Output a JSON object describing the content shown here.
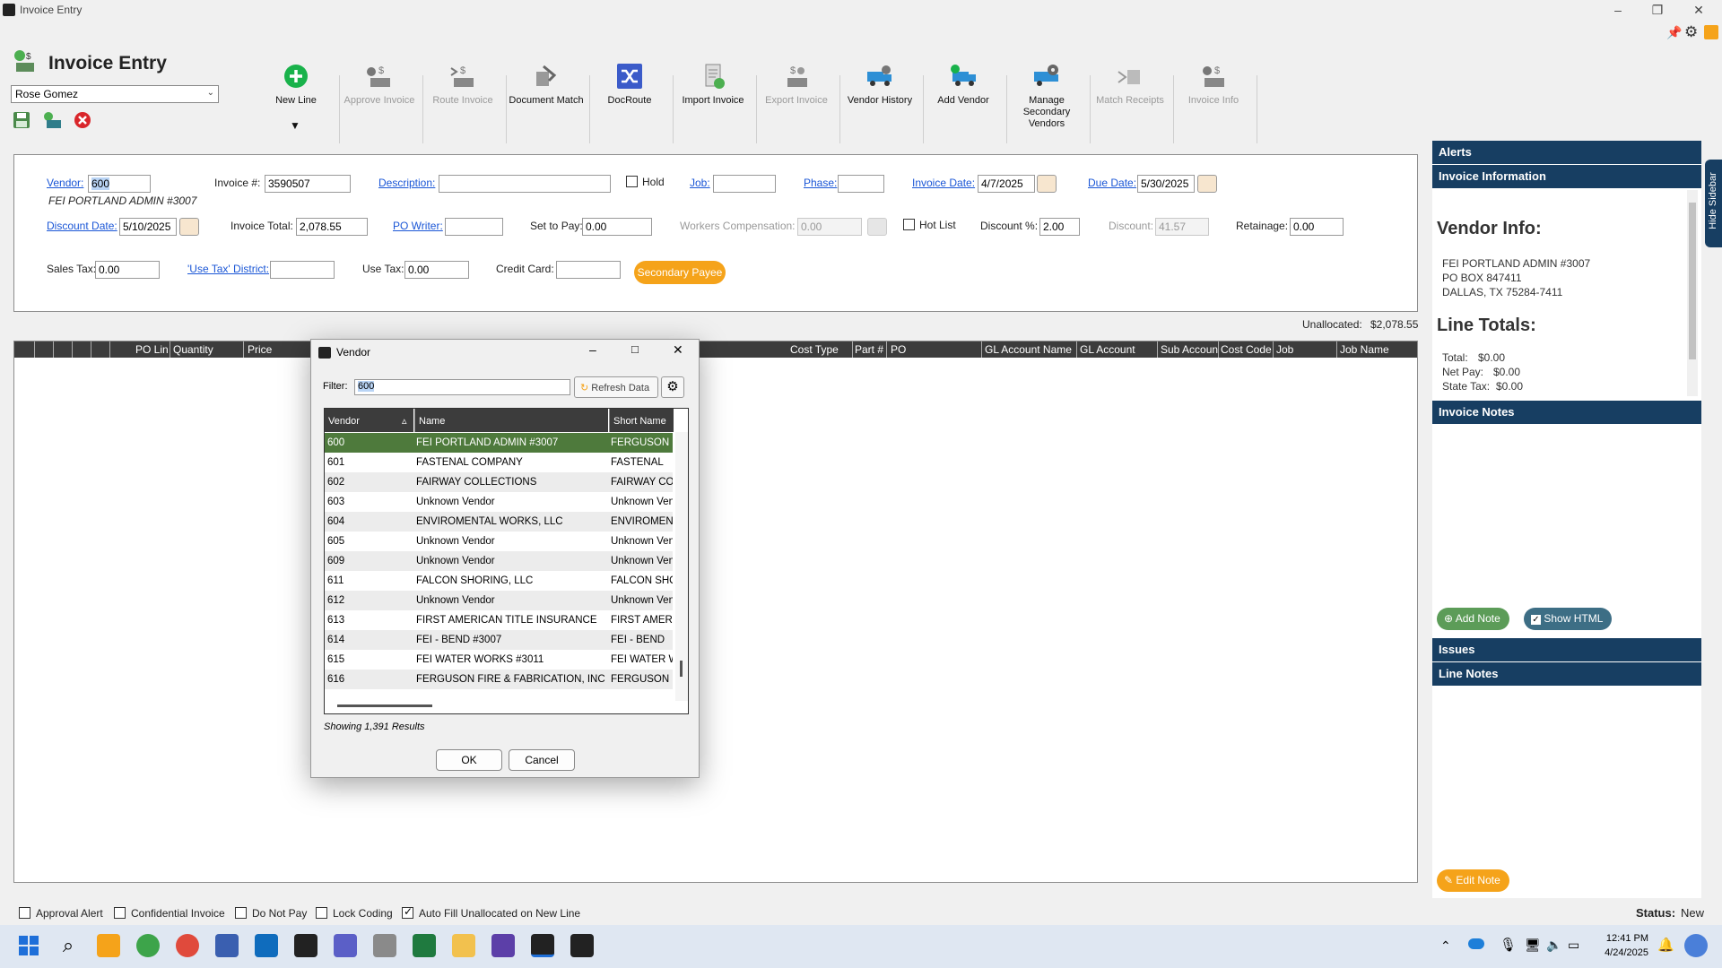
{
  "window": {
    "title": "Invoice Entry"
  },
  "header": {
    "title": "Invoice Entry",
    "user_select": "Rose Gomez"
  },
  "ribbon": [
    {
      "label": "New Line",
      "enabled": true,
      "icon": "plus-circle-icon"
    },
    {
      "label": "Approve Invoice",
      "enabled": false,
      "icon": "approve-invoice-icon"
    },
    {
      "label": "Route Invoice",
      "enabled": false,
      "icon": "route-invoice-icon"
    },
    {
      "label": "Document Match",
      "enabled": true,
      "icon": "document-match-icon"
    },
    {
      "label": "DocRoute",
      "enabled": true,
      "icon": "shuffle-icon"
    },
    {
      "label": "Import Invoice",
      "enabled": true,
      "icon": "import-invoice-icon"
    },
    {
      "label": "Export Invoice",
      "enabled": false,
      "icon": "export-invoice-icon"
    },
    {
      "label": "Vendor History",
      "enabled": true,
      "icon": "truck-history-icon"
    },
    {
      "label": "Add Vendor",
      "enabled": true,
      "icon": "add-vendor-icon"
    },
    {
      "label": "Manage Secondary Vendors",
      "enabled": true,
      "icon": "manage-vendors-icon"
    },
    {
      "label": "Match Receipts",
      "enabled": false,
      "icon": "match-receipts-icon"
    },
    {
      "label": "Invoice Info",
      "enabled": false,
      "icon": "invoice-info-icon"
    }
  ],
  "ribbon_dropdown_glyph": "▼",
  "form": {
    "vendor_label": "Vendor:",
    "vendor_value": "600",
    "vendor_name": "FEI PORTLAND ADMIN #3007",
    "invoice_no_label": "Invoice #:",
    "invoice_no_value": "3590507",
    "description_label": "Description:",
    "description_value": "",
    "hold_label": "Hold",
    "job_label": "Job:",
    "job_value": "",
    "phase_label": "Phase:",
    "phase_value": "",
    "invoice_date_label": "Invoice Date:",
    "invoice_date_value": "4/7/2025",
    "due_date_label": "Due Date:",
    "due_date_value": "5/30/2025",
    "discount_date_label": "Discount Date:",
    "discount_date_value": "5/10/2025",
    "invoice_total_label": "Invoice Total:",
    "invoice_total_value": "2,078.55",
    "po_writer_label": "PO Writer:",
    "po_writer_value": "",
    "set_to_pay_label": "Set to Pay:",
    "set_to_pay_value": "0.00",
    "workers_comp_label": "Workers Compensation:",
    "workers_comp_value": "0.00",
    "hot_list_label": "Hot List",
    "discount_pct_label": "Discount %:",
    "discount_pct_value": "2.00",
    "discount_label": "Discount:",
    "discount_value": "41.57",
    "retainage_label": "Retainage:",
    "retainage_value": "0.00",
    "sales_tax_label": "Sales Tax:",
    "sales_tax_value": "0.00",
    "use_tax_district_label": "'Use Tax' District:",
    "use_tax_district_value": "",
    "use_tax_label": "Use Tax:",
    "use_tax_value": "0.00",
    "credit_card_label": "Credit Card:",
    "credit_card_value": "",
    "secondary_payee_label": "Secondary Payee"
  },
  "unallocated": {
    "label": "Unallocated:",
    "value": "$2,078.55"
  },
  "grid_columns": [
    "PO Line",
    "Quantity",
    "Price",
    "Cost Type",
    "Part #",
    "PO",
    "GL Account Name",
    "GL Account",
    "Sub Account",
    "Cost Code",
    "Job",
    "Job Name"
  ],
  "sidebar": {
    "alerts": "Alerts",
    "invoice_information": "Invoice Information",
    "vendor_info_title": "Vendor Info:",
    "vendor_lines": [
      "FEI PORTLAND ADMIN #3007",
      "PO BOX 847411",
      "DALLAS, TX 75284-7411"
    ],
    "line_totals_title": "Line Totals:",
    "totals": [
      {
        "label": "Total:",
        "value": "$0.00"
      },
      {
        "label": "Net Pay:",
        "value": "$0.00"
      },
      {
        "label": "State Tax:",
        "value": "$0.00"
      }
    ],
    "invoice_notes": "Invoice Notes",
    "add_note": "Add Note",
    "show_html": "Show HTML",
    "issues": "Issues",
    "line_notes": "Line Notes",
    "edit_note": "Edit Note",
    "hide_sidebar": "Hide Sidebar"
  },
  "dialog": {
    "title": "Vendor",
    "filter_label": "Filter:",
    "filter_value": "600",
    "refresh_label": "Refresh Data",
    "columns": [
      "Vendor",
      "Name",
      "Short Name"
    ],
    "rows": [
      {
        "vendor": "600",
        "name": "FEI PORTLAND ADMIN #3007",
        "short": "FERGUSON",
        "selected": true
      },
      {
        "vendor": "601",
        "name": "FASTENAL COMPANY",
        "short": "FASTENAL"
      },
      {
        "vendor": "602",
        "name": "FAIRWAY COLLECTIONS",
        "short": "FAIRWAY COI"
      },
      {
        "vendor": "603",
        "name": "Unknown Vendor",
        "short": "Unknown Vend"
      },
      {
        "vendor": "604",
        "name": "ENVIROMENTAL WORKS, LLC",
        "short": "ENVIROMENT"
      },
      {
        "vendor": "605",
        "name": "Unknown Vendor",
        "short": "Unknown Vend"
      },
      {
        "vendor": "609",
        "name": "Unknown Vendor",
        "short": "Unknown Vend"
      },
      {
        "vendor": "611",
        "name": "FALCON SHORING, LLC",
        "short": "FALCON SHO"
      },
      {
        "vendor": "612",
        "name": "Unknown Vendor",
        "short": "Unknown Vend"
      },
      {
        "vendor": "613",
        "name": "FIRST AMERICAN TITLE INSURANCE",
        "short": "FIRST AMERI"
      },
      {
        "vendor": "614",
        "name": "FEI - BEND #3007",
        "short": "FEI - BEND"
      },
      {
        "vendor": "615",
        "name": "FEI WATER WORKS  #3011",
        "short": "FEI WATER W"
      },
      {
        "vendor": "616",
        "name": "FERGUSON FIRE & FABRICATION, INC",
        "short": "FERGUSON F"
      }
    ],
    "results": "Showing 1,391 Results",
    "ok": "OK",
    "cancel": "Cancel"
  },
  "bottom": {
    "checks": [
      {
        "label": "Approval Alert",
        "checked": false
      },
      {
        "label": "Confidential Invoice",
        "checked": false
      },
      {
        "label": "Do Not Pay",
        "checked": false
      },
      {
        "label": "Lock Coding",
        "checked": false
      },
      {
        "label": "Auto Fill Unallocated on New Line",
        "checked": true
      }
    ],
    "status_label": "Status:",
    "status_value": "New"
  },
  "taskbar": {
    "time": "12:41 PM",
    "date": "4/24/2025"
  },
  "colors": {
    "accent_navy": "#173e62",
    "selected_row": "#4e7a3c",
    "orange": "#f5a31a",
    "green_btn": "#5c9c58",
    "teal_btn": "#3d6e85"
  }
}
